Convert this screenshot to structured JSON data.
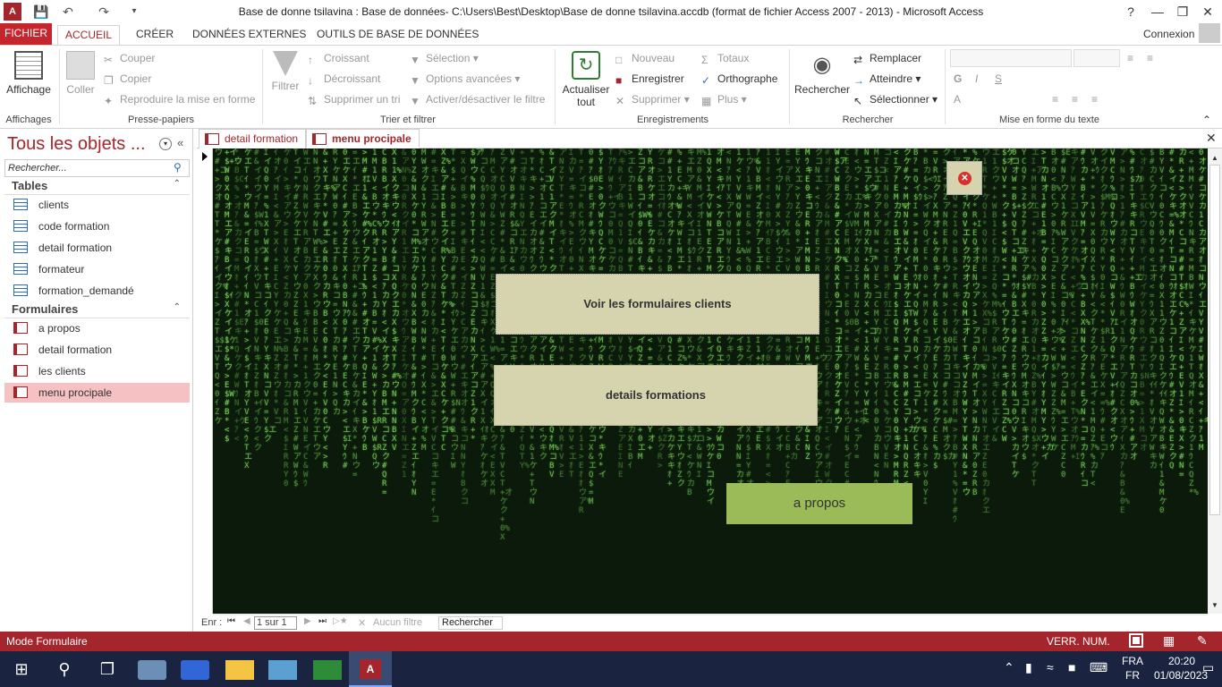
{
  "window": {
    "title": "Base de donne tsilavina : Base de données- C:\\Users\\Best\\Desktop\\Base de donne tsilavina.accdb (format de fichier Access 2007 - 2013) - Microsoft Access",
    "help": "?",
    "connexion": "Connexion"
  },
  "ribbon_tabs": {
    "file": "FICHIER",
    "home": "ACCUEIL",
    "create": "CRÉER",
    "external": "DONNÉES EXTERNES",
    "tools": "OUTILS DE BASE DE DONNÉES"
  },
  "ribbon": {
    "views": {
      "affichage": "Affichage",
      "label": "Affichages"
    },
    "clipboard": {
      "coller": "Coller",
      "couper": "Couper",
      "copier": "Copier",
      "reproduire": "Reproduire la mise en forme",
      "label": "Presse-papiers"
    },
    "sort": {
      "filtrer": "Filtrer",
      "croissant": "Croissant",
      "decroissant": "Décroissant",
      "supprimer_tri": "Supprimer un tri",
      "selection": "Sélection",
      "options": "Options avancées",
      "activer": "Activer/désactiver le filtre",
      "label": "Trier et filtrer"
    },
    "records": {
      "actualiser": "Actualiser",
      "tout": "tout",
      "nouveau": "Nouveau",
      "enregistrer": "Enregistrer",
      "supprimer": "Supprimer",
      "totaux": "Totaux",
      "orthographe": "Orthographe",
      "plus": "Plus",
      "label": "Enregistrements"
    },
    "find": {
      "rechercher": "Rechercher",
      "remplacer": "Remplacer",
      "atteindre": "Atteindre",
      "selectionner": "Sélectionner",
      "label": "Rechercher"
    },
    "text": {
      "label": "Mise en forme du texte"
    }
  },
  "nav": {
    "title": "Tous les objets ...",
    "search_placeholder": "Rechercher...",
    "tables_label": "Tables",
    "tables": [
      "clients",
      "code formation",
      "detail formation",
      "formateur",
      "formation_demandé"
    ],
    "forms_label": "Formulaires",
    "forms": [
      "a propos",
      "detail formation",
      "les clients",
      "menu procipale"
    ]
  },
  "doc_tabs": [
    "detail formation",
    "menu procipale"
  ],
  "form": {
    "btn_clients": "Voir les formulaires clients",
    "btn_details": "details formations",
    "btn_apropos": "a propos"
  },
  "record_nav": {
    "prefix": "Enr :",
    "position": "1 sur 1",
    "filter": "Aucun filtre",
    "search": "Rechercher"
  },
  "status": {
    "mode": "Mode Formulaire",
    "indicators": "VERR. NUM."
  },
  "taskbar": {
    "lang1": "FRA",
    "lang2": "FR",
    "time": "20:20",
    "date": "01/08/2023"
  },
  "colors": {
    "accent": "#a4262c",
    "button": "#d6d3af",
    "apropos": "#9bbb59",
    "matrix": "#7fcf5e"
  }
}
